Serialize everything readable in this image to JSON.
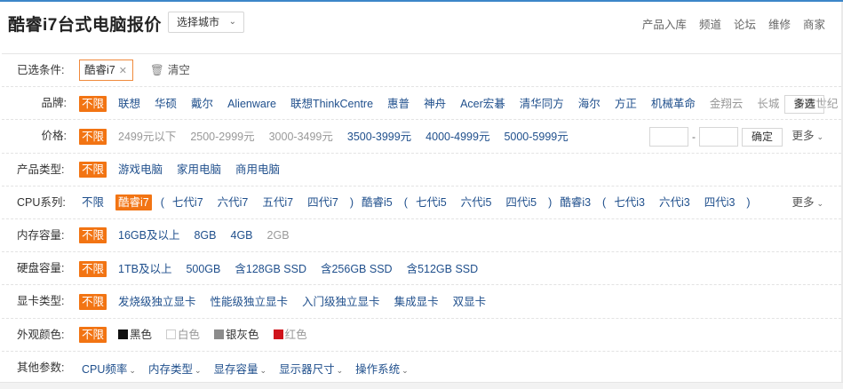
{
  "header": {
    "title": "酷睿i7台式电脑报价",
    "city_select": "选择城市",
    "nav": [
      "产品入库",
      "频道",
      "论坛",
      "维修",
      "商家"
    ]
  },
  "filters": {
    "selected": {
      "label": "已选条件:",
      "chip": "酷睿i7",
      "clear": "清空"
    },
    "brand": {
      "label": "品牌:",
      "options": [
        "不限",
        "联想",
        "华硕",
        "戴尔",
        "Alienware",
        "联想ThinkCentre",
        "惠普",
        "神舟",
        "Acer宏碁",
        "清华同方",
        "海尔",
        "方正",
        "机械革命"
      ],
      "gray_options": [
        "金翔云",
        "长城",
        "雷霆世纪"
      ],
      "more": "多选"
    },
    "price": {
      "label": "价格:",
      "options": [
        "不限",
        "2499元以下",
        "2500-2999元",
        "3000-3499元",
        "3500-3999元",
        "4000-4999元",
        "5000-5999元"
      ],
      "range_dash": "-",
      "confirm": "确定",
      "more": "更多"
    },
    "type": {
      "label": "产品类型:",
      "options": [
        "不限",
        "游戏电脑",
        "家用电脑",
        "商用电脑"
      ]
    },
    "cpu": {
      "label": "CPU系列:",
      "options": [
        "不限",
        "酷睿i7",
        "(",
        "七代i7",
        "六代i7",
        "五代i7",
        "四代i7",
        ")",
        "酷睿i5",
        "(",
        "七代i5",
        "六代i5",
        "四代i5",
        ")",
        "酷睿i3",
        "(",
        "七代i3",
        "六代i3",
        "四代i3",
        ")"
      ],
      "more": "更多"
    },
    "memory": {
      "label": "内存容量:",
      "options": [
        "不限",
        "16GB及以上",
        "8GB",
        "4GB",
        "2GB"
      ]
    },
    "disk": {
      "label": "硬盘容量:",
      "options": [
        "不限",
        "1TB及以上",
        "500GB",
        "含128GB SSD",
        "含256GB SSD",
        "含512GB SSD"
      ]
    },
    "gpu": {
      "label": "显卡类型:",
      "options": [
        "不限",
        "发烧级独立显卡",
        "性能级独立显卡",
        "入门级独立显卡",
        "集成显卡",
        "双显卡"
      ]
    },
    "color": {
      "label": "外观颜色:",
      "unlimited": "不限",
      "options": [
        {
          "name": "黑色",
          "swatch": "#111111"
        },
        {
          "name": "白色",
          "swatch": "#ffffff"
        },
        {
          "name": "银灰色",
          "swatch": "#8c8c8c"
        },
        {
          "name": "红色",
          "swatch": "#d0141c"
        }
      ]
    },
    "other": {
      "label": "其他参数:",
      "dropdowns": [
        "CPU频率",
        "内存类型",
        "显存容量",
        "显示器尺寸",
        "操作系统"
      ]
    }
  },
  "colors": {
    "accent": "#f27413",
    "link": "#1f4f8c",
    "topbar": "#3c86c8"
  }
}
